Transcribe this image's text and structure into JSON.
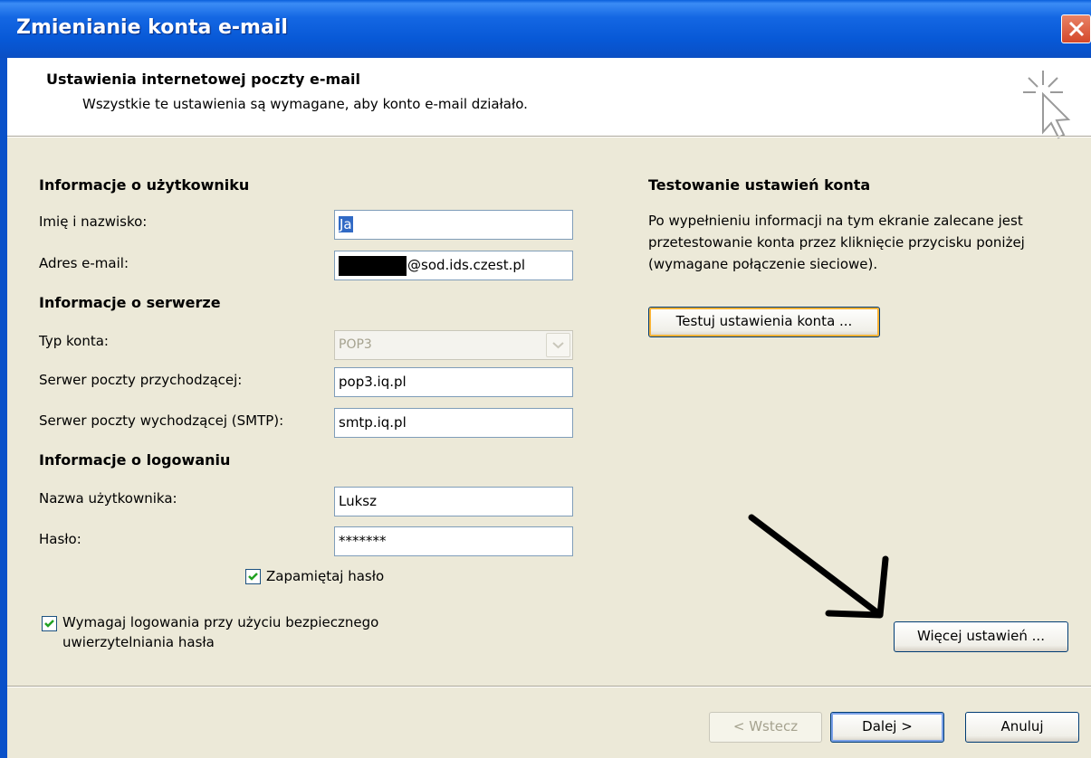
{
  "window": {
    "title": "Zmienianie konta e-mail"
  },
  "header": {
    "title": "Ustawienia internetowej poczty e-mail",
    "subtitle": "Wszystkie te ustawienia są wymagane, aby konto e-mail działało."
  },
  "user_info": {
    "heading": "Informacje o użytkowniku",
    "name_label": "Imię i nazwisko:",
    "name_value": "Ja",
    "email_label": "Adres e-mail:",
    "email_value": "@sod.ids.czest.pl"
  },
  "server_info": {
    "heading": "Informacje o serwerze",
    "account_type_label": "Typ konta:",
    "account_type_value": "POP3",
    "incoming_label": "Serwer poczty przychodzącej:",
    "incoming_value": "pop3.iq.pl",
    "outgoing_label": "Serwer poczty wychodzącej (SMTP):",
    "outgoing_value": "smtp.iq.pl"
  },
  "logon_info": {
    "heading": "Informacje o logowaniu",
    "username_label": "Nazwa użytkownika:",
    "username_value": "Luksz",
    "password_label": "Hasło:",
    "password_value": "*******",
    "remember_label": "Zapamiętaj hasło",
    "remember_checked": true,
    "spa_label_line1": "Wymagaj logowania przy użyciu bezpiecznego",
    "spa_label_line2": "uwierzytelniania hasła",
    "spa_checked": true
  },
  "test_section": {
    "heading": "Testowanie ustawień konta",
    "desc_line1": "Po wypełnieniu informacji na tym ekranie zalecane jest",
    "desc_line2": "przetestowanie konta przez kliknięcie przycisku poniżej",
    "desc_line3": "(wymagane połączenie sieciowe).",
    "test_button": "Testuj ustawienia konta ..."
  },
  "more_settings_button": "Więcej ustawień ...",
  "footer": {
    "back_button": "< Wstecz",
    "next_button": "Dalej >",
    "cancel_button": "Anuluj"
  },
  "colors": {
    "title_bar": "#0758d6",
    "dialog_bg": "#ece9d8",
    "selection": "#316ac5"
  }
}
